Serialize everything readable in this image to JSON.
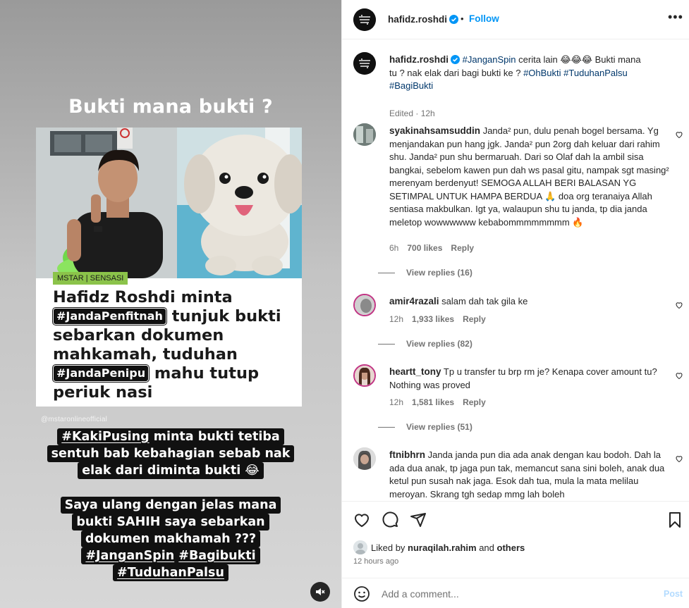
{
  "media": {
    "story_title": "Bukti mana bukti ?",
    "card_tag": "MSTAR | SENSASI",
    "headline": {
      "line1": "Hafidz Roshdi minta",
      "pill1": "#JandaPenfitnah",
      "after_pill1": " tunjuk bukti",
      "line3": "sebarkan dokumen",
      "line4": "mahkamah, tuduhan",
      "pill2": "#JandaPenipu",
      "after_pill2": " mahu tutup",
      "line6": "periuk nasi"
    },
    "watermark": "@mstaronlineofficial",
    "caption1": {
      "tag": "#KakiPusing",
      "line1_rest": " minta bukti tetiba",
      "line2": "sentuh bab kebahagian sebab nak",
      "line3": "elak dari diminta bukti 😂"
    },
    "caption2": {
      "line1": "Saya ulang dengan jelas mana",
      "line2": "bukti SAHIH saya sebarkan",
      "line3": "dokumen makhamah ???",
      "tag1": "#JanganSpin",
      "tag2": "#Bagibukti",
      "tag3": "#TuduhanPalsu"
    }
  },
  "header": {
    "username": "hafidz.roshdi",
    "follow_label": "Follow",
    "separator": "•",
    "more_label": "•••"
  },
  "post": {
    "username": "hafidz.roshdi",
    "tag1": "#JanganSpin",
    "text1": " cerita lain 😂😂😂 Bukti mana tu ? nak elak dari bagi bukti ke ? ",
    "tag2": "#OhBukti",
    "tag3": "#TuduhanPalsu",
    "tag4": "#BagiBukti",
    "edited": "Edited · 12h"
  },
  "comments": [
    {
      "username": "syakinahsamsuddin",
      "text": "Janda² pun, dulu penah bogel bersama. Yg menjandakan pun hang jgk. Janda² pun 2org dah keluar dari rahim shu. Janda² pun shu bermaruah. Dari so Olaf dah la ambil sisa bangkai, sebelom kawen pun dah ws pasal gitu, nampak sgt masing² merenyam berdenyut! SEMOGA ALLAH BERI BALASAN YG SETIMPAL UNTUK HAMPA BERDUA 🙏 doa org teranaiya Allah sentiasa makbulkan. Igt ya, walaupun shu tu janda, tp dia janda meletop wowwwwww kebabommmmmmmm 🔥",
      "time": "6h",
      "likes": "700 likes",
      "reply": "Reply",
      "view_replies": "View replies (16)"
    },
    {
      "username": "amir4razali",
      "text": "salam dah tak gila ke",
      "time": "12h",
      "likes": "1,933 likes",
      "reply": "Reply",
      "view_replies": "View replies (82)"
    },
    {
      "username": "heartt_tony",
      "text": "Tp u transfer tu brp rm je? Kenapa cover amount tu? Nothing was proved",
      "time": "12h",
      "likes": "1,581 likes",
      "reply": "Reply",
      "view_replies": "View replies (51)"
    },
    {
      "username": "ftnibhrn",
      "text": "Janda janda pun dia ada anak dengan kau bodoh. Dah la ada dua anak, tp jaga pun tak, memancut sana sini boleh, anak dua ketul pun susah nak jaga. Esok dah tua, mula la mata melilau meroyan. Skrang tgh sedap mmg lah boleh",
      "time": "",
      "likes": "",
      "reply": "",
      "view_replies": ""
    }
  ],
  "likes_section": {
    "liked_by_prefix": "Liked by ",
    "liked_by_user": "nuraqilah.rahim",
    "liked_by_suffix": " and ",
    "others": "others",
    "time_ago": "12 hours ago"
  },
  "add_comment": {
    "placeholder": "Add a comment...",
    "post_label": "Post"
  },
  "colors": {
    "link": "#0095f6",
    "hashtag": "#00376b",
    "muted": "#737373",
    "tag_green": "#8bc34a"
  }
}
